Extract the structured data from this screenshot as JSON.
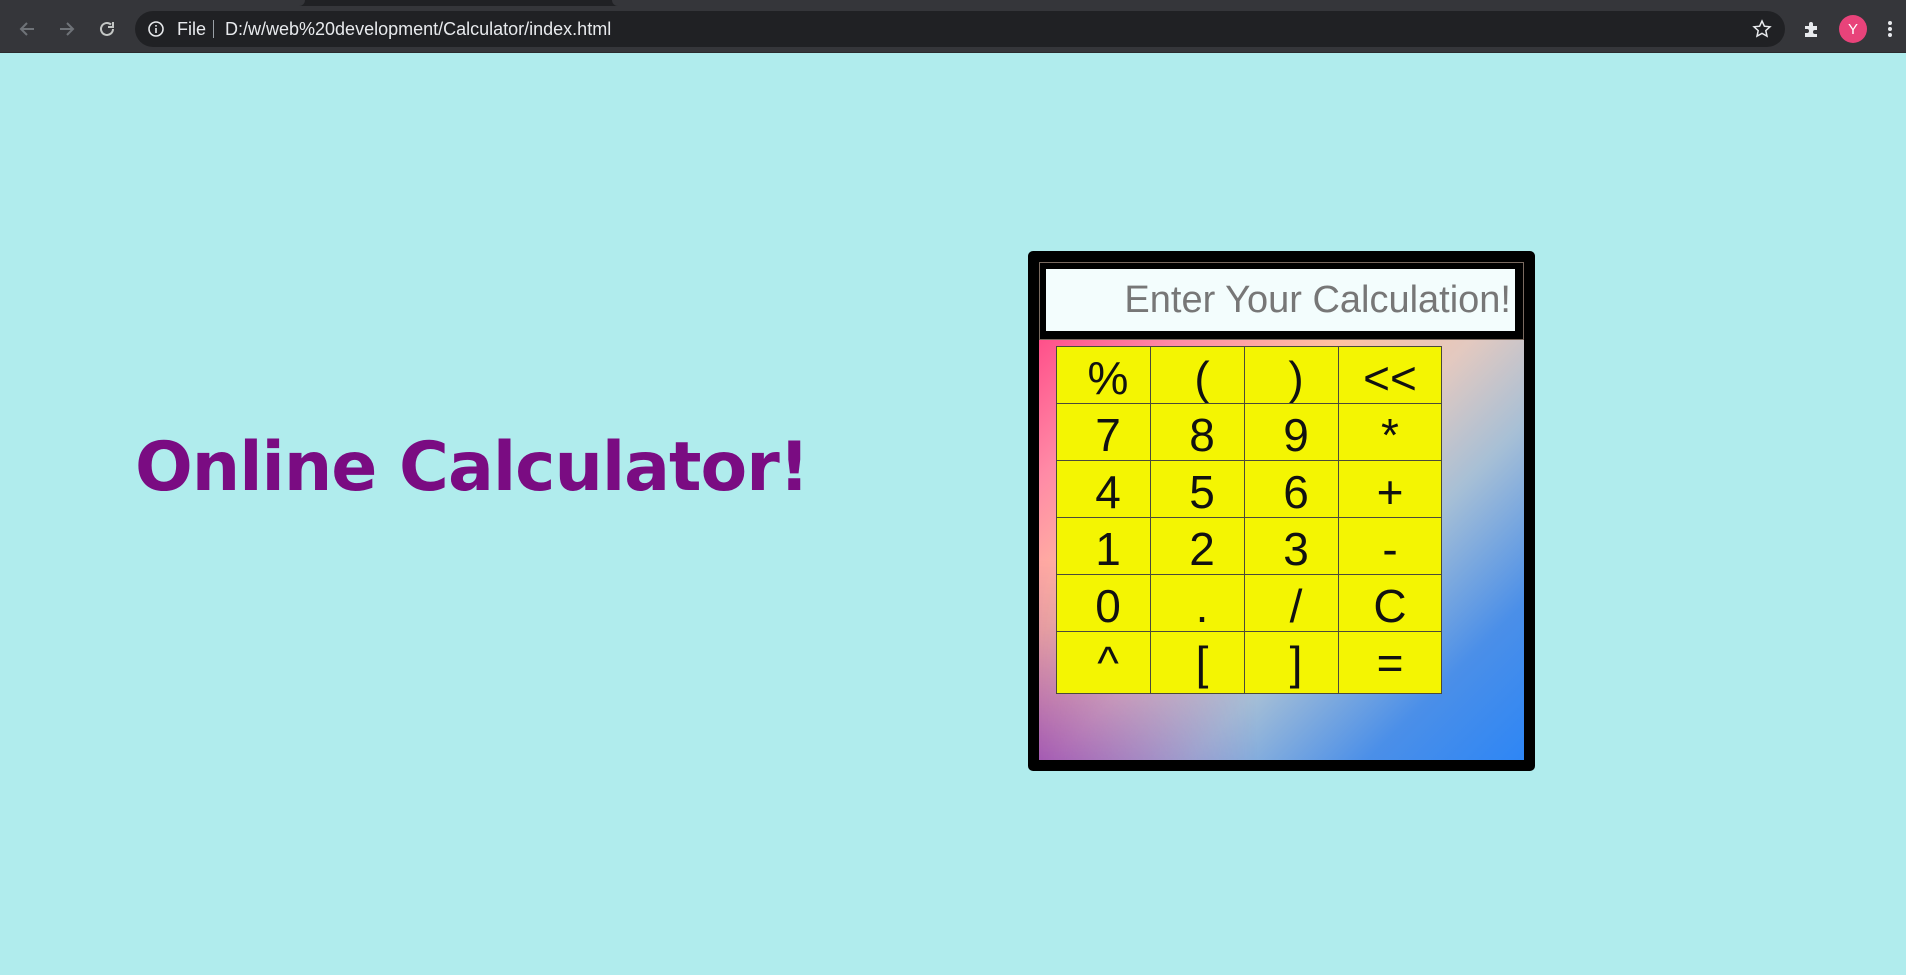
{
  "browser": {
    "info_label": "File",
    "url": "D:/w/web%20development/Calculator/index.html",
    "avatar_initial": "Y",
    "icons": [
      "back-arrow-icon",
      "forward-arrow-icon",
      "reload-icon",
      "info-icon",
      "star-icon",
      "extensions-puzzle-icon",
      "menu-dots-icon"
    ]
  },
  "page": {
    "heading": "Online Calculator!",
    "background_color": "#b0eced",
    "heading_color": "#7a0c82"
  },
  "calculator": {
    "display_placeholder": "Enter Your Calculation!",
    "display_value": "",
    "key_color": "#f4f502",
    "keys": [
      [
        "%",
        "(",
        ")",
        "<<"
      ],
      [
        "7",
        "8",
        "9",
        "*"
      ],
      [
        "4",
        "5",
        "6",
        "+"
      ],
      [
        "1",
        "2",
        "3",
        "-"
      ],
      [
        "0",
        ".",
        "/",
        "C"
      ],
      [
        "^",
        "[",
        "]",
        "="
      ]
    ]
  }
}
